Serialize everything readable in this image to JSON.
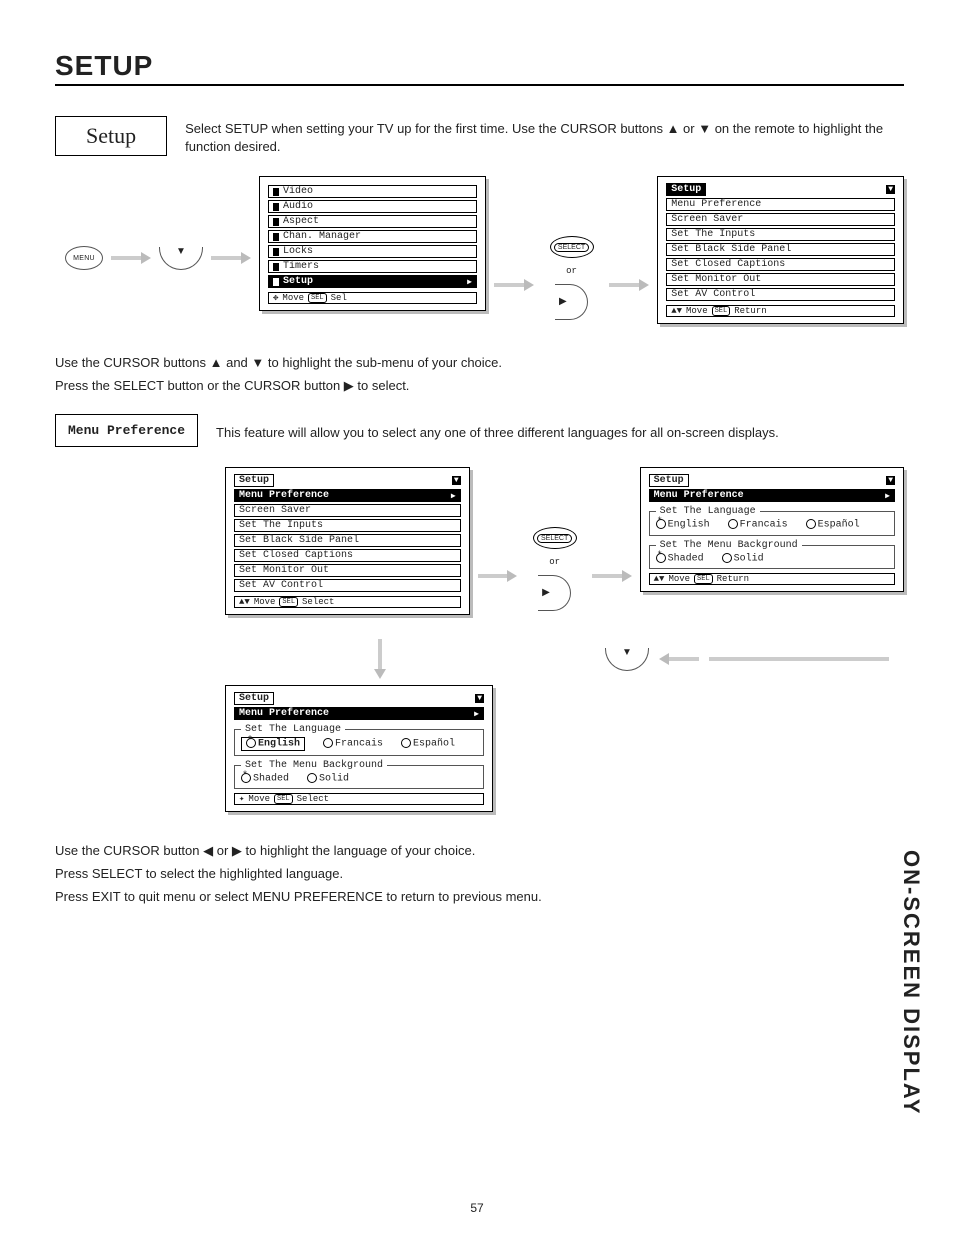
{
  "page_number": "57",
  "side_label": "ON-SCREEN DISPLAY",
  "title": "SETUP",
  "setup_box_label": "Setup",
  "setup_intro": "Select SETUP when setting your TV up for the first time.  Use the CURSOR buttons ▲ or ▼ on the remote to highlight the function desired.",
  "menu_button_label": "MENU",
  "select_button_label": "SELECT",
  "or_label": "or",
  "main_menu_hint": {
    "move": "Move",
    "sel": "Sel",
    "button_icon": "SEL"
  },
  "setup_menu_hint_return": {
    "move": "Move",
    "ret": "Return",
    "button_icon": "SEL"
  },
  "setup_menu_hint_select": {
    "move": "Move",
    "ret": "Select",
    "button_icon": "SEL"
  },
  "mid_text_line1": "Use the CURSOR buttons ▲ and ▼ to highlight the sub-menu of your choice.",
  "mid_text_line2": "Press the SELECT button or the CURSOR button ▶ to select.",
  "menu_pref_box_label": "Menu Preference",
  "menu_pref_desc": "This feature will allow you to select any one of three different languages for all on-screen displays.",
  "bottom_text_line1": "Use the CURSOR button ◀ or ▶ to highlight the language of your choice.",
  "bottom_text_line2": "Press SELECT to select the highlighted language.",
  "bottom_text_line3": "Press EXIT to quit menu or select MENU PREFERENCE to return to previous menu.",
  "main_menu": {
    "items": [
      "Video",
      "Audio",
      "Aspect",
      "Chan. Manager",
      "Locks",
      "Timers",
      "Setup"
    ],
    "highlight": "Setup"
  },
  "setup_menu": {
    "header": "Setup",
    "items": [
      "Menu Preference",
      "Screen Saver",
      "Set The Inputs",
      "Set Black Side Panel",
      "Set Closed Captions",
      "Set Monitor Out",
      "Set AV Control"
    ]
  },
  "pref_panel": {
    "header": "Setup",
    "sub_highlight": "Menu Preference",
    "group1_legend": "Set The Language",
    "group1_options": [
      "English",
      "Francais",
      "Español"
    ],
    "group2_legend": "Set The Menu Background",
    "group2_options": [
      "Shaded",
      "Solid"
    ]
  }
}
